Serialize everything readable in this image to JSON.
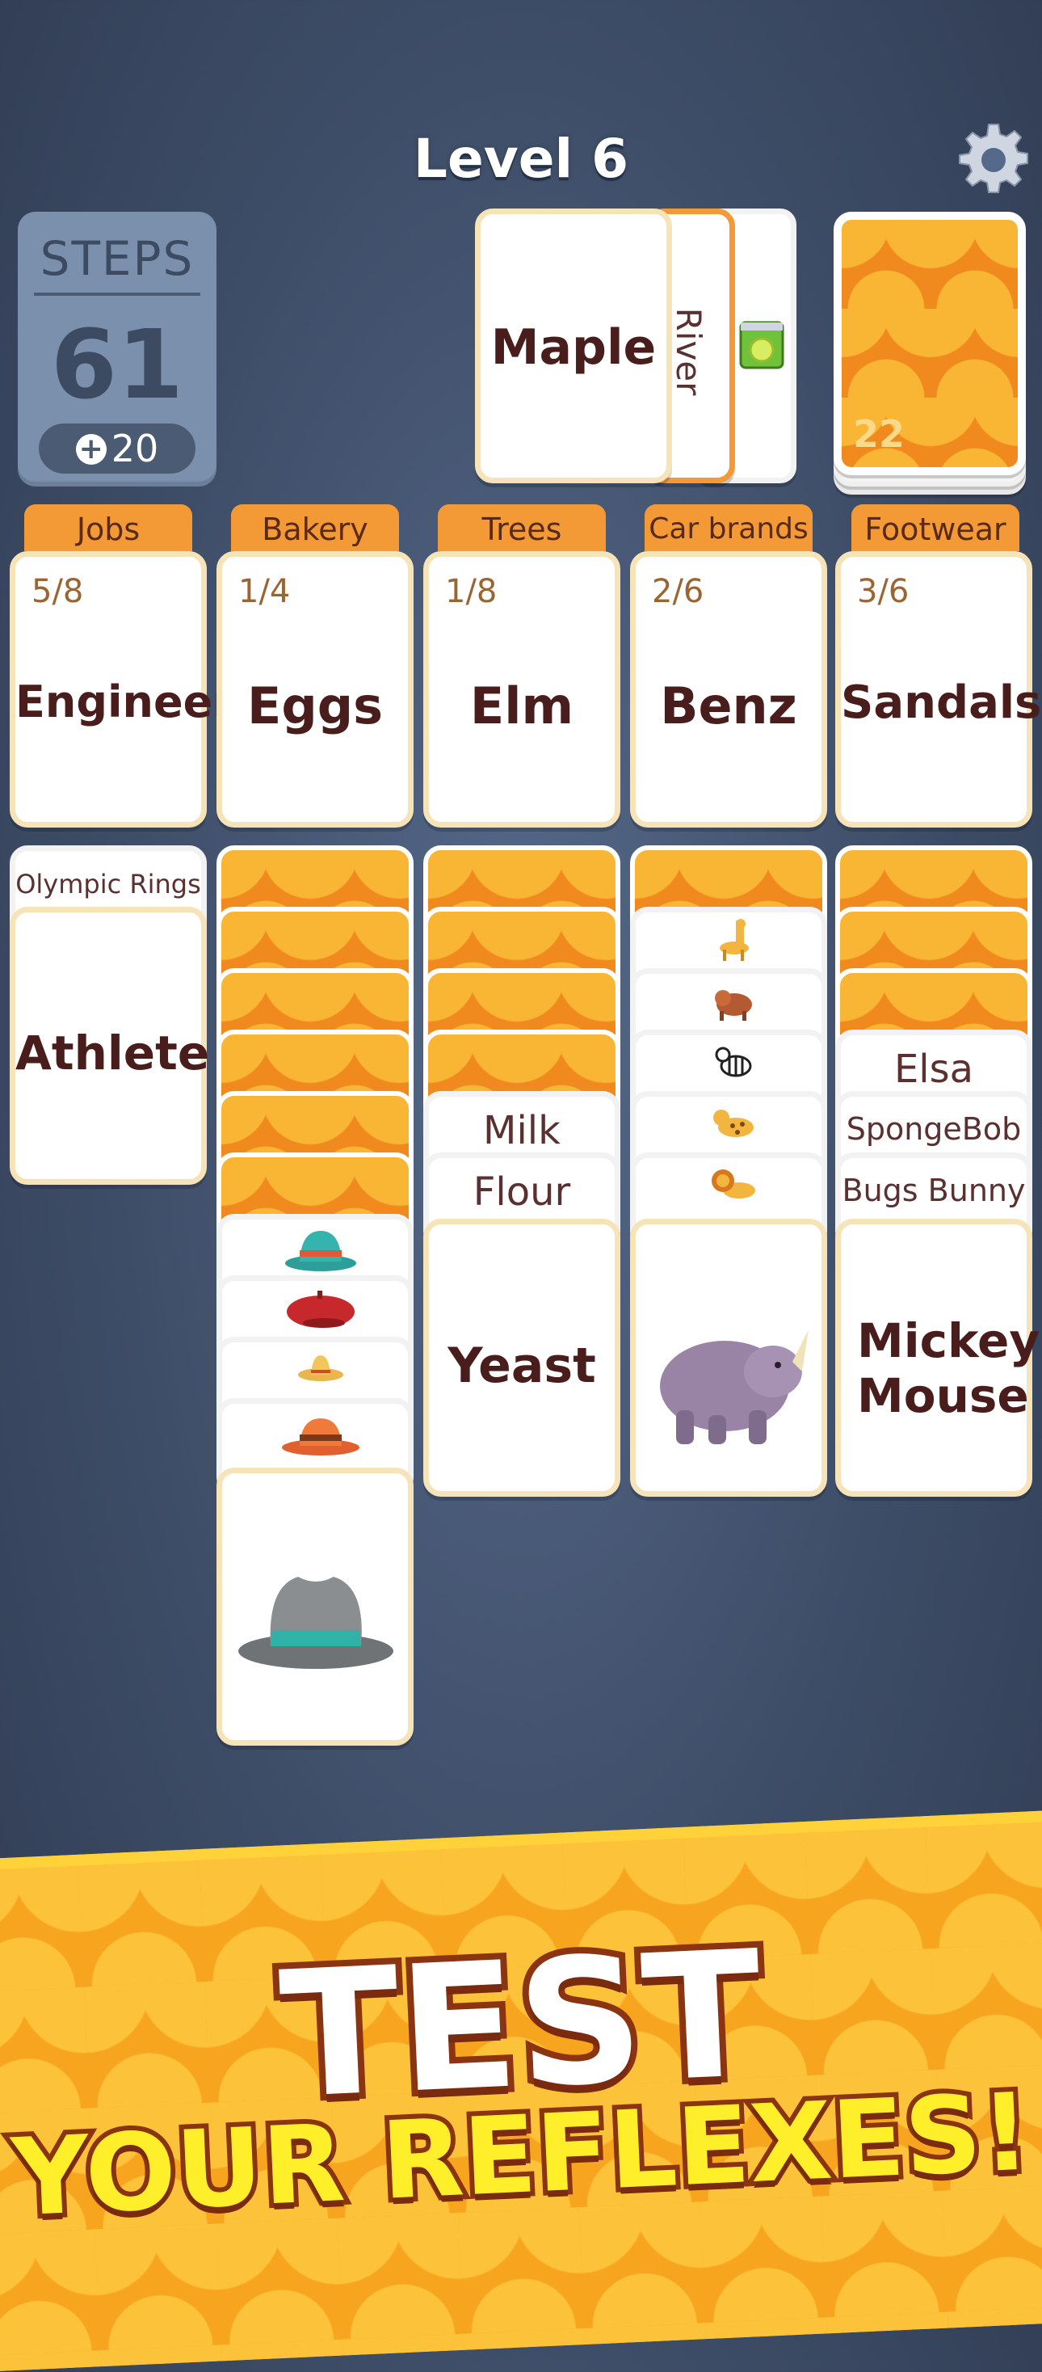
{
  "header": {
    "level_title": "Level 6"
  },
  "steps": {
    "label": "STEPS",
    "value": "61",
    "add_label": "20"
  },
  "waste": {
    "top_card": "Maple",
    "second_card": "River",
    "third_card_icon": "lime-can-icon"
  },
  "deck": {
    "remaining": "22"
  },
  "categories": [
    {
      "name": "Jobs",
      "progress": "5/8",
      "card": "Engineer"
    },
    {
      "name": "Bakery",
      "progress": "1/4",
      "card": "Eggs"
    },
    {
      "name": "Trees",
      "progress": "1/8",
      "card": "Elm"
    },
    {
      "name": "Car brands",
      "progress": "2/6",
      "card": "Benz"
    },
    {
      "name": "Footwear",
      "progress": "3/6",
      "card": "Sandals"
    }
  ],
  "columns": {
    "col1": {
      "peek": "Olympic Rings",
      "top": "Athlete"
    },
    "col2": {
      "hidden_count": 6,
      "peek_icons": [
        "teal-hat-icon",
        "red-beret-icon",
        "sombrero-icon",
        "orange-hat-icon"
      ],
      "top_icon": "gray-fedora-icon"
    },
    "col3": {
      "hidden_count": 4,
      "peek": [
        "Milk",
        "Flour"
      ],
      "top": "Yeast"
    },
    "col4": {
      "hidden_count": 1,
      "peek_icons": [
        "giraffe-icon",
        "warthog-icon",
        "zebra-icon",
        "leopard-icon",
        "lion-icon"
      ],
      "top_icon": "rhino-icon"
    },
    "col5": {
      "hidden_count": 3,
      "peek": [
        "Elsa",
        "SpongeBob",
        "Bugs Bunny"
      ],
      "top": "Mickey Mouse"
    }
  },
  "banner": {
    "line1": "TEST",
    "line2": "YOUR REFLEXES!"
  }
}
